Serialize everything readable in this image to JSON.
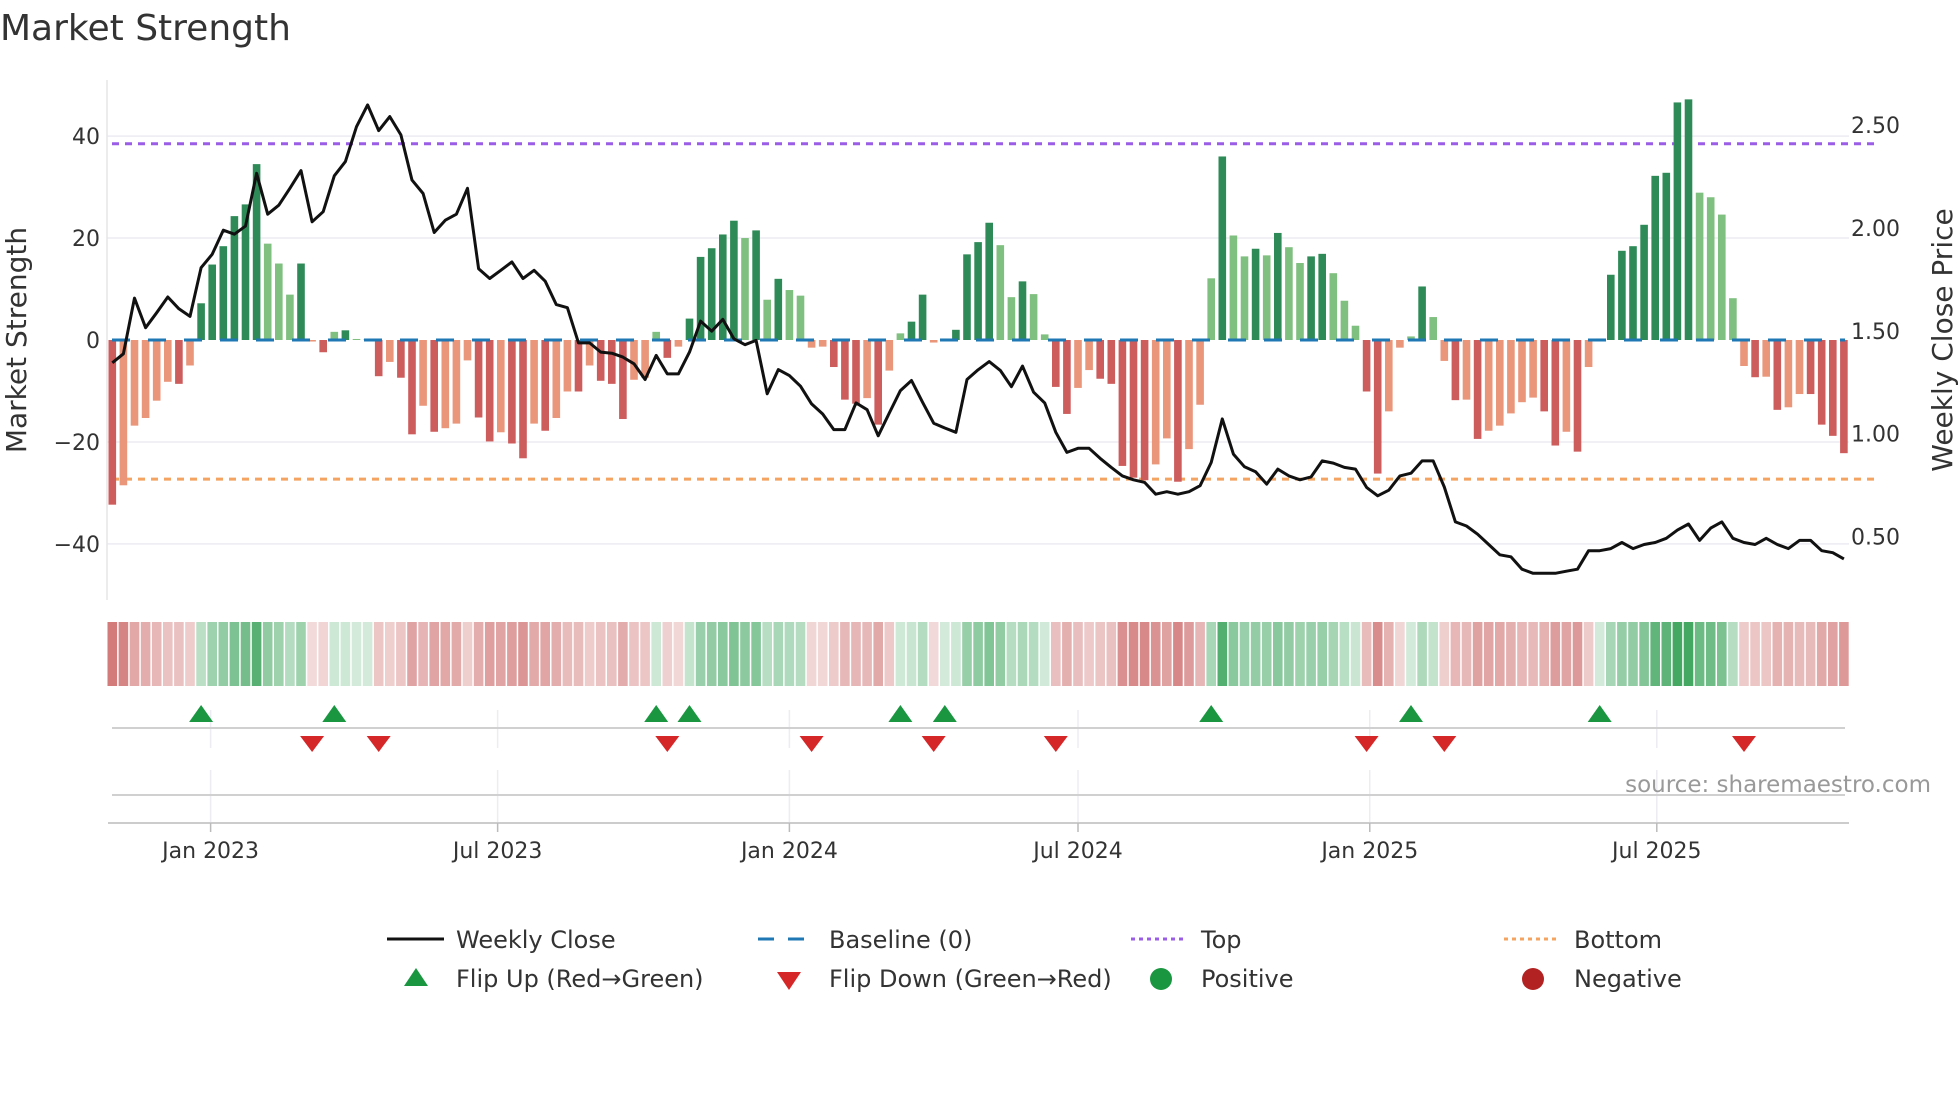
{
  "title": "Market Strength",
  "source": "source: sharemaestro.com",
  "colors": {
    "pos_strong": "#2e8b57",
    "pos_weak": "#7fbf7f",
    "neg_strong": "#cd5c5c",
    "neg_weak": "#e9967a",
    "baseline": "#1f77b4",
    "top": "#9b5de5",
    "bottom": "#f4a460",
    "flip_up": "#1a9641",
    "flip_down": "#d62728",
    "positive": "#1a9641",
    "negative": "#b22222",
    "line": "#111111"
  },
  "chart_data": {
    "type": "bar",
    "title": "Market Strength",
    "ylabel": "Market Strength",
    "y2label": "Weekly Close Price",
    "start_week": "2022-10-31",
    "interval_days": 7,
    "ylim": [
      -51,
      51
    ],
    "y2lim": [
      0.19,
      2.72
    ],
    "yticks": [
      {
        "v": 40,
        "label": "40"
      },
      {
        "v": 20,
        "label": "20"
      },
      {
        "v": 0,
        "label": "0"
      },
      {
        "v": -20,
        "label": "−20"
      },
      {
        "v": -40,
        "label": "−40"
      }
    ],
    "y2ticks": [
      {
        "v": 2.5,
        "label": "2.50"
      },
      {
        "v": 2.0,
        "label": "2.00"
      },
      {
        "v": 1.5,
        "label": "1.50"
      },
      {
        "v": 1.0,
        "label": "1.00"
      },
      {
        "v": 0.5,
        "label": "0.50"
      }
    ],
    "xticks": [
      {
        "date": "2023-01-01",
        "label": "Jan 2023"
      },
      {
        "date": "2023-07-01",
        "label": "Jul 2023"
      },
      {
        "date": "2024-01-01",
        "label": "Jan 2024"
      },
      {
        "date": "2024-07-01",
        "label": "Jul 2024"
      },
      {
        "date": "2025-01-01",
        "label": "Jan 2025"
      },
      {
        "date": "2025-07-01",
        "label": "Jul 2025"
      }
    ],
    "top_level": 38.5,
    "bottom_level": -27.3,
    "grid": true,
    "strength": [
      -32.3,
      -28.5,
      -16.8,
      -15.3,
      -11.9,
      -8.2,
      -8.6,
      -5,
      7.2,
      14.8,
      18.4,
      24.3,
      26.6,
      34.5,
      18.9,
      15,
      8.9,
      15,
      -0.3,
      -2.4,
      1.6,
      1.9,
      0.2,
      0.2,
      -7.1,
      -4.3,
      -7.4,
      -18.5,
      -12.9,
      -18,
      -17.3,
      -16.4,
      -4,
      -15.2,
      -19.9,
      -18.1,
      -20.3,
      -23.2,
      -16.4,
      -17.8,
      -15.3,
      -10.1,
      -10.1,
      -5,
      -8,
      -8.6,
      -15.5,
      -7.8,
      -7.4,
      1.6,
      -3.5,
      -1.3,
      4.2,
      16.3,
      18,
      20.7,
      23.4,
      20,
      21.5,
      7.9,
      12,
      9.8,
      8.7,
      -1.5,
      -1.3,
      -5.3,
      -11.7,
      -12.5,
      -11.4,
      -16.6,
      -6,
      1.3,
      3.6,
      8.9,
      -0.5,
      0.3,
      2,
      16.8,
      19.2,
      23,
      18.6,
      8.4,
      11.5,
      9,
      1.1,
      -9.2,
      -14.5,
      -9.4,
      -5.9,
      -7.6,
      -8.6,
      -24.7,
      -27,
      -27.5,
      -24.4,
      -19.3,
      -27.8,
      -21.4,
      -12.7,
      12.1,
      36,
      20.5,
      16.4,
      17.9,
      16.6,
      21,
      18.2,
      15.1,
      16.4,
      16.9,
      13.1,
      7.7,
      2.8,
      -10.1,
      -26.2,
      -14,
      -1.5,
      0.7,
      10.5,
      4.5,
      -4.1,
      -11.8,
      -11.7,
      -19.4,
      -17.8,
      -16.8,
      -14.4,
      -12.2,
      -11.3,
      -14,
      -20.7,
      -18,
      -21.9,
      -5.3,
      0.3,
      12.8,
      17.5,
      18.4,
      22.6,
      32.2,
      32.8,
      46.6,
      47.2,
      28.9,
      28,
      24.6,
      8.2,
      -5.1,
      -7.3,
      -7.2,
      -13.7,
      -13.2,
      -10.6,
      -10.6,
      -16.6,
      -18.8,
      -22.2
    ],
    "weekly_close": [
      1.344,
      1.388,
      1.659,
      1.515,
      1.588,
      1.664,
      1.607,
      1.57,
      1.807,
      1.872,
      1.989,
      1.97,
      2.009,
      2.266,
      2.067,
      2.111,
      2.193,
      2.279,
      2.03,
      2.079,
      2.254,
      2.323,
      2.493,
      2.599,
      2.474,
      2.542,
      2.453,
      2.233,
      2.168,
      1.978,
      2.038,
      2.067,
      2.193,
      1.802,
      1.754,
      1.794,
      1.835,
      1.754,
      1.794,
      1.741,
      1.627,
      1.612,
      1.441,
      1.441,
      1.396,
      1.391,
      1.372,
      1.339,
      1.263,
      1.38,
      1.29,
      1.29,
      1.396,
      1.547,
      1.498,
      1.555,
      1.461,
      1.432,
      1.453,
      1.193,
      1.311,
      1.282,
      1.23,
      1.144,
      1.095,
      1.019,
      1.019,
      1.149,
      1.116,
      0.989,
      1.1,
      1.209,
      1.258,
      1.152,
      1.05,
      1.027,
      1.006,
      1.263,
      1.31,
      1.35,
      1.307,
      1.228,
      1.328,
      1.201,
      1.149,
      1.006,
      0.908,
      0.928,
      0.928,
      0.879,
      0.835,
      0.794,
      0.775,
      0.762,
      0.705,
      0.717,
      0.705,
      0.717,
      0.746,
      0.859,
      1.071,
      0.9,
      0.838,
      0.814,
      0.754,
      0.827,
      0.794,
      0.775,
      0.789,
      0.867,
      0.856,
      0.835,
      0.827,
      0.738,
      0.697,
      0.724,
      0.794,
      0.807,
      0.867,
      0.867,
      0.74,
      0.57,
      0.55,
      0.51,
      0.46,
      0.41,
      0.4,
      0.34,
      0.32,
      0.32,
      0.32,
      0.33,
      0.34,
      0.43,
      0.43,
      0.44,
      0.47,
      0.44,
      0.46,
      0.47,
      0.49,
      0.53,
      0.56,
      0.48,
      0.54,
      0.57,
      0.49,
      0.47,
      0.46,
      0.49,
      0.46,
      0.44,
      0.48,
      0.48,
      0.43,
      0.42,
      0.39
    ],
    "flip_up_weeks": [
      8,
      20,
      49,
      52,
      71,
      75,
      99,
      117,
      134
    ],
    "flip_down_weeks": [
      18,
      24,
      50,
      63,
      74,
      85,
      113,
      120,
      147
    ],
    "legend": {
      "weekly_close": "Weekly Close",
      "baseline": "Baseline (0)",
      "top": "Top",
      "bottom": "Bottom",
      "flip_up": "Flip Up (Red→Green)",
      "flip_down": "Flip Down (Green→Red)",
      "positive": "Positive",
      "negative": "Negative"
    },
    "legend_position": "bottom"
  }
}
